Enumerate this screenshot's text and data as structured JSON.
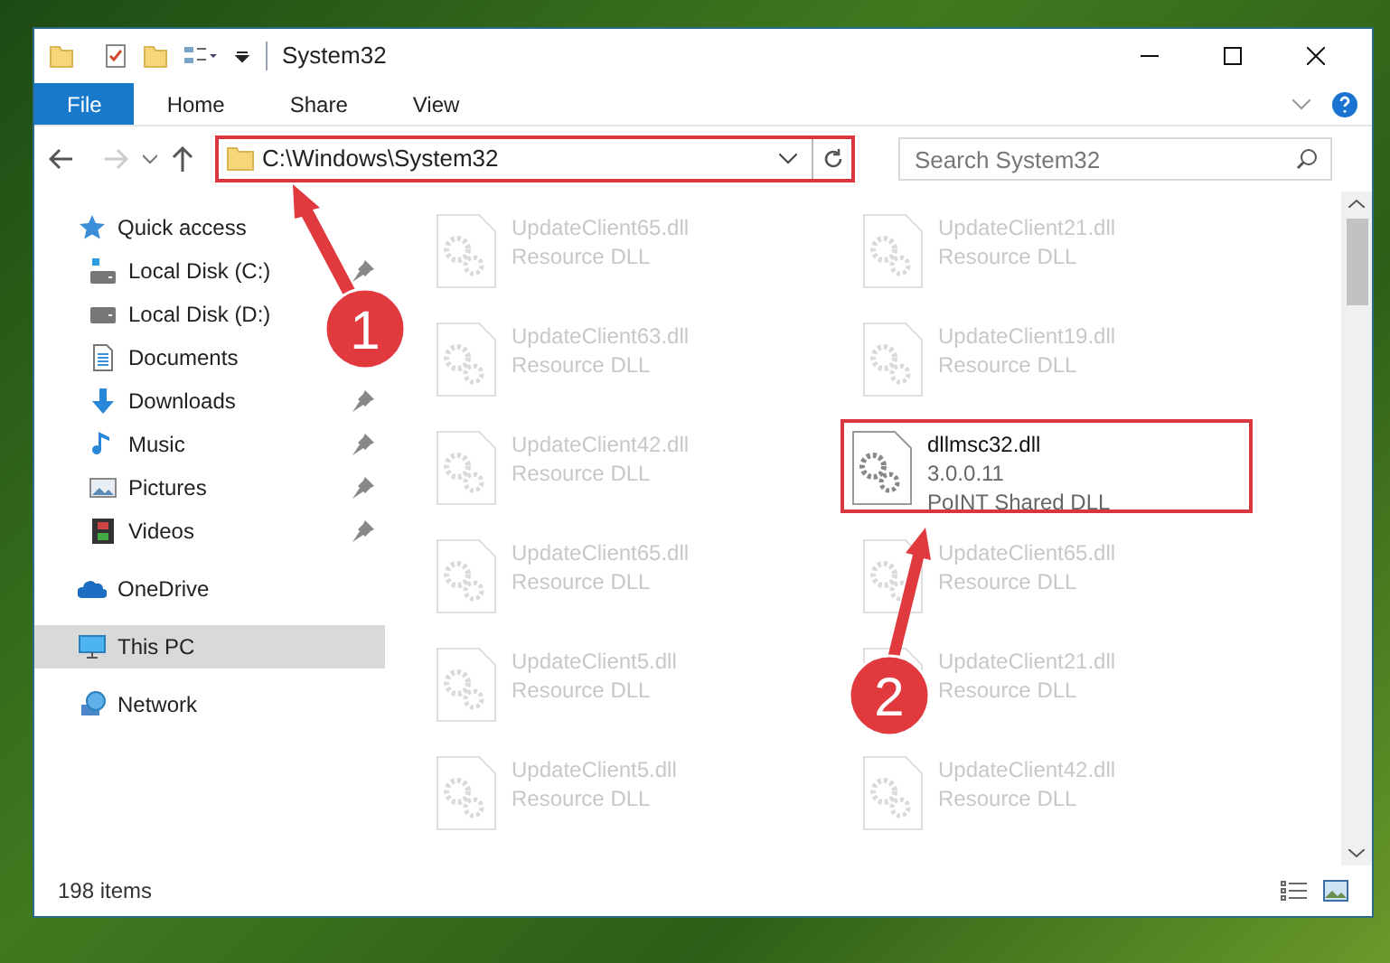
{
  "window": {
    "title": "System32"
  },
  "ribbon_tabs": [
    {
      "label": "File",
      "selected": true
    },
    {
      "label": "Home",
      "selected": false
    },
    {
      "label": "Share",
      "selected": false
    },
    {
      "label": "View",
      "selected": false
    }
  ],
  "address": {
    "path": "C:\\Windows\\System32",
    "highlighted": true
  },
  "search": {
    "placeholder": "Search System32"
  },
  "sidebar": {
    "items": [
      {
        "label": "Quick access",
        "kind": "star",
        "selected": false,
        "children": [
          {
            "label": "Local Disk (C:)",
            "kind": "drivec",
            "pinned": true,
            "selected": false
          },
          {
            "label": "Local Disk (D:)",
            "kind": "drive",
            "pinned": false,
            "selected": false
          },
          {
            "label": "Documents",
            "kind": "documents",
            "pinned": false,
            "selected": false
          },
          {
            "label": "Downloads",
            "kind": "downloads",
            "pinned": true,
            "selected": false
          },
          {
            "label": "Music",
            "kind": "music",
            "pinned": true,
            "selected": false
          },
          {
            "label": "Pictures",
            "kind": "pictures",
            "pinned": true,
            "selected": false
          },
          {
            "label": "Videos",
            "kind": "videos",
            "pinned": true,
            "selected": false
          }
        ]
      },
      {
        "label": "OneDrive",
        "kind": "onedrive",
        "selected": false
      },
      {
        "label": "This PC",
        "kind": "pc",
        "selected": true
      },
      {
        "label": "Network",
        "kind": "network",
        "selected": false
      }
    ]
  },
  "files": [
    {
      "name": "UpdateClient65.dll",
      "lines": [
        "Resource DLL"
      ],
      "dimmed": true,
      "highlighted": false
    },
    {
      "name": "UpdateClient21.dll",
      "lines": [
        "Resource DLL"
      ],
      "dimmed": true,
      "highlighted": false
    },
    {
      "name": "UpdateClient63.dll",
      "lines": [
        "Resource DLL"
      ],
      "dimmed": true,
      "highlighted": false
    },
    {
      "name": "UpdateClient19.dll",
      "lines": [
        "Resource DLL"
      ],
      "dimmed": true,
      "highlighted": false
    },
    {
      "name": "UpdateClient42.dll",
      "lines": [
        "Resource DLL"
      ],
      "dimmed": true,
      "highlighted": false
    },
    {
      "name": "dllmsc32.dll",
      "lines": [
        "3.0.0.11",
        "PoINT Shared DLL"
      ],
      "dimmed": false,
      "highlighted": true
    },
    {
      "name": "UpdateClient65.dll",
      "lines": [
        "Resource DLL"
      ],
      "dimmed": true,
      "highlighted": false
    },
    {
      "name": "UpdateClient65.dll",
      "lines": [
        "Resource DLL"
      ],
      "dimmed": true,
      "highlighted": false
    },
    {
      "name": "UpdateClient5.dll",
      "lines": [
        "Resource DLL"
      ],
      "dimmed": true,
      "highlighted": false
    },
    {
      "name": "UpdateClient21.dll",
      "lines": [
        "Resource DLL"
      ],
      "dimmed": true,
      "highlighted": false
    },
    {
      "name": "UpdateClient5.dll",
      "lines": [
        "Resource DLL"
      ],
      "dimmed": true,
      "highlighted": false
    },
    {
      "name": "UpdateClient42.dll",
      "lines": [
        "Resource DLL"
      ],
      "dimmed": true,
      "highlighted": false
    }
  ],
  "status_bar": {
    "count": "198 items"
  },
  "annotations": [
    {
      "label": "1"
    },
    {
      "label": "2"
    }
  ]
}
